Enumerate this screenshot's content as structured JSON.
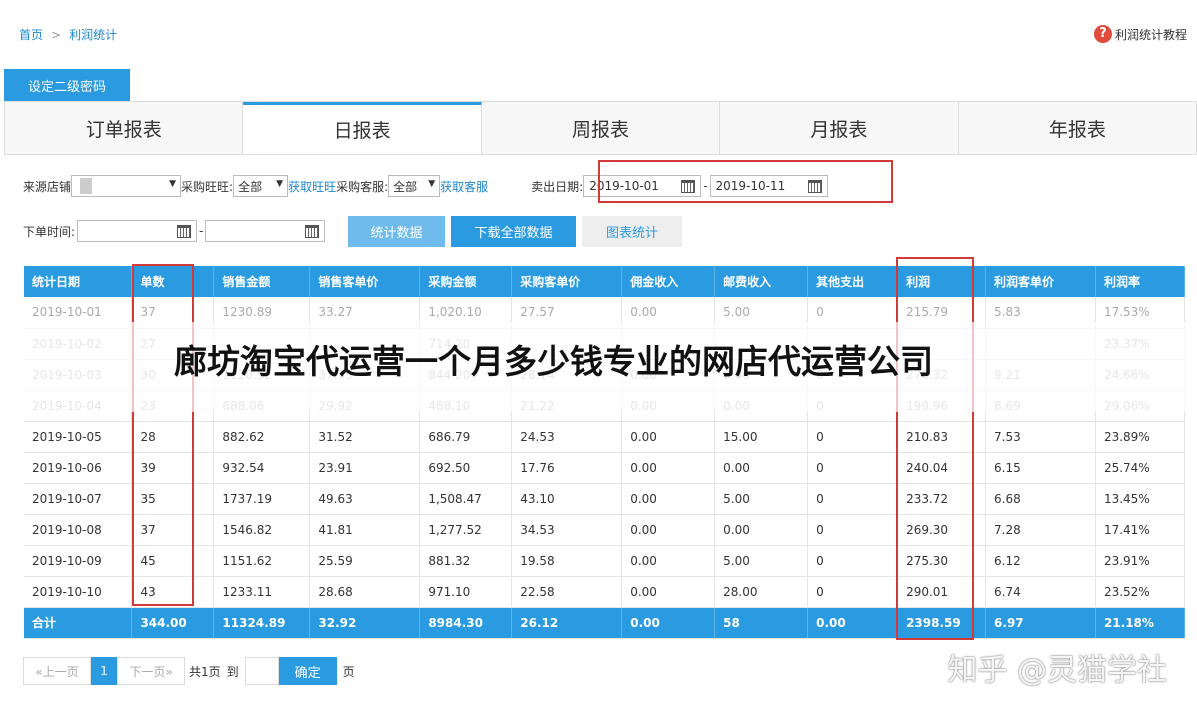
{
  "breadcrumb": {
    "home": "首页",
    "sep": ">",
    "current": "利润统计"
  },
  "help": {
    "icon": "question-icon",
    "label": "利润统计教程"
  },
  "password_button": "设定二级密码",
  "tabs": [
    "订单报表",
    "日报表",
    "周报表",
    "月报表",
    "年报表"
  ],
  "active_tab": "日报表",
  "filters": {
    "store_label": "来源店铺",
    "wangwang_label": "采购旺旺:",
    "wangwang_value": "全部",
    "wangwang_link": "获取旺旺",
    "service_label": "采购客服:",
    "service_value": "全部",
    "service_link": "获取客服",
    "sell_date_label": "卖出日期:",
    "sell_date_from": "2019-10-01",
    "sell_date_to": "2019-10-11",
    "dash": "-",
    "order_time_label": "下单时间:"
  },
  "buttons": {
    "stat": "统计数据",
    "download": "下载全部数据",
    "chart": "图表统计"
  },
  "table": {
    "headers": [
      "统计日期",
      "单数",
      "销售金额",
      "销售客单价",
      "采购金额",
      "采购客单价",
      "佣金收入",
      "邮费收入",
      "其他支出",
      "利润",
      "利润客单价",
      "利润率"
    ],
    "rows": [
      [
        "2019-10-01",
        "37",
        "1230.89",
        "33.27",
        "1,020.10",
        "27.57",
        "0.00",
        "5.00",
        "0",
        "215.79",
        "5.83",
        "17.53%"
      ],
      [
        "2019-10-02",
        "27",
        "",
        "",
        "714.20",
        "",
        "",
        "",
        "",
        "",
        "",
        "23.37%"
      ],
      [
        "2019-10-03",
        "30",
        "1120.52",
        "37.35",
        "844.20",
        "28.14",
        "0.00",
        "0.00",
        "0",
        "276.32",
        "9.21",
        "24.66%"
      ],
      [
        "2019-10-04",
        "23",
        "688.06",
        "29.92",
        "488.10",
        "21.22",
        "0.00",
        "0.00",
        "0",
        "199.96",
        "8.69",
        "29.06%"
      ],
      [
        "2019-10-05",
        "28",
        "882.62",
        "31.52",
        "686.79",
        "24.53",
        "0.00",
        "15.00",
        "0",
        "210.83",
        "7.53",
        "23.89%"
      ],
      [
        "2019-10-06",
        "39",
        "932.54",
        "23.91",
        "692.50",
        "17.76",
        "0.00",
        "0.00",
        "0",
        "240.04",
        "6.15",
        "25.74%"
      ],
      [
        "2019-10-07",
        "35",
        "1737.19",
        "49.63",
        "1,508.47",
        "43.10",
        "0.00",
        "5.00",
        "0",
        "233.72",
        "6.68",
        "13.45%"
      ],
      [
        "2019-10-08",
        "37",
        "1546.82",
        "41.81",
        "1,277.52",
        "34.53",
        "0.00",
        "0.00",
        "0",
        "269.30",
        "7.28",
        "17.41%"
      ],
      [
        "2019-10-09",
        "45",
        "1151.62",
        "25.59",
        "881.32",
        "19.58",
        "0.00",
        "5.00",
        "0",
        "275.30",
        "6.12",
        "23.91%"
      ],
      [
        "2019-10-10",
        "43",
        "1233.11",
        "28.68",
        "971.10",
        "22.58",
        "0.00",
        "28.00",
        "0",
        "290.01",
        "6.74",
        "23.52%"
      ]
    ],
    "total": [
      "合计",
      "344.00",
      "11324.89",
      "32.92",
      "8984.30",
      "26.12",
      "0.00",
      "58",
      "0.00",
      "2398.59",
      "6.97",
      "21.18%"
    ]
  },
  "overlay_title": "廊坊淘宝代运营一个月多少钱专业的网店代运营公司",
  "pager": {
    "prev": "«上一页",
    "current": "1",
    "next": "下一页»",
    "total": "共1页",
    "goto": "到",
    "confirm": "确定",
    "page_unit": "页"
  },
  "watermark": "知乎 @灵猫学社",
  "colors": {
    "accent": "#2a9be0",
    "highlight_box": "#d23a3a"
  }
}
